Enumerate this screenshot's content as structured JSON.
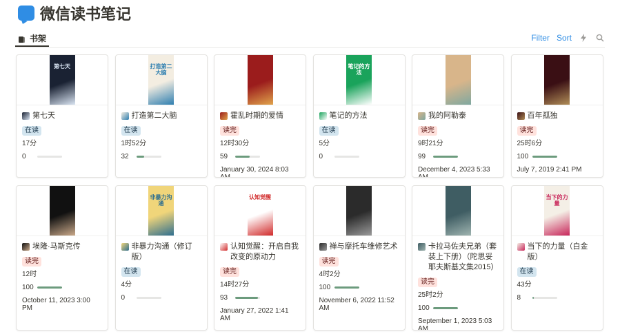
{
  "app": {
    "title": "微信读书笔记"
  },
  "view": {
    "tab_label": "书架",
    "filter_label": "Filter",
    "sort_label": "Sort",
    "lightning_icon": "lightning-icon",
    "search_icon": "search-icon"
  },
  "colors": {
    "accent": "#2f8de4",
    "reading_tag_bg": "#d3e5ef",
    "done_tag_bg": "#ffe2dd",
    "progress": "#6c9b7d"
  },
  "books": [
    {
      "title": "第七天",
      "status": "在读",
      "status_type": "reading",
      "time": "17分",
      "progress_label": "0",
      "progress": 0,
      "date": "",
      "cover_colors": [
        "#1a2233",
        "#d9e4f2"
      ],
      "cover_text": "第七天"
    },
    {
      "title": "打造第二大脑",
      "status": "在读",
      "status_type": "reading",
      "time": "1时52分",
      "progress_label": "32",
      "progress": 32,
      "date": "",
      "cover_colors": [
        "#f3ede1",
        "#2f7fb0"
      ],
      "cover_text": "打造第二大脑"
    },
    {
      "title": "霍乱时期的爱情",
      "status": "读完",
      "status_type": "done",
      "time": "12时30分",
      "progress_label": "59",
      "progress": 59,
      "date": "January 30, 2024 8:03 AM",
      "cover_colors": [
        "#9b1c1c",
        "#e0a34b"
      ],
      "cover_text": ""
    },
    {
      "title": "笔记的方法",
      "status": "在读",
      "status_type": "reading",
      "time": "5分",
      "progress_label": "0",
      "progress": 0,
      "date": "",
      "cover_colors": [
        "#1aa35b",
        "#ffffff"
      ],
      "cover_text": "笔记的方法"
    },
    {
      "title": "我的阿勒泰",
      "status": "读完",
      "status_type": "done",
      "time": "9时21分",
      "progress_label": "99",
      "progress": 99,
      "date": "December 4, 2023 5:33 AM",
      "cover_colors": [
        "#d8b58a",
        "#7fa8a0"
      ],
      "cover_text": ""
    },
    {
      "title": "百年孤独",
      "status": "读完",
      "status_type": "done",
      "time": "25时6分",
      "progress_label": "100",
      "progress": 100,
      "date": "July 7, 2019 2:41 PM",
      "cover_colors": [
        "#3a0f14",
        "#b08d57"
      ],
      "cover_text": ""
    },
    {
      "title": "埃隆·马斯克传",
      "status": "读完",
      "status_type": "done",
      "time": "12时",
      "progress_label": "100",
      "progress": 100,
      "date": "October 11, 2023 3:00 PM",
      "cover_colors": [
        "#111111",
        "#caa98a"
      ],
      "cover_text": ""
    },
    {
      "title": "非暴力沟通（修订版）",
      "status": "在读",
      "status_type": "reading",
      "time": "4分",
      "progress_label": "0",
      "progress": 0,
      "date": "",
      "cover_colors": [
        "#f0d57a",
        "#2f6f8f"
      ],
      "cover_text": "非暴力沟通"
    },
    {
      "title": "认知觉醒：开启自我改变的原动力",
      "status": "读完",
      "status_type": "done",
      "time": "14时27分",
      "progress_label": "93",
      "progress": 93,
      "date": "January 27, 2022 1:41 AM",
      "cover_colors": [
        "#ffffff",
        "#d12a2a"
      ],
      "cover_text": "认知觉醒"
    },
    {
      "title": "禅与摩托车维修艺术",
      "status": "读完",
      "status_type": "done",
      "time": "4时2分",
      "progress_label": "100",
      "progress": 100,
      "date": "November 6, 2022 11:52 AM",
      "cover_colors": [
        "#2b2b2b",
        "#9a9a9a"
      ],
      "cover_text": ""
    },
    {
      "title": "卡拉马佐夫兄弟（套装上下册）（陀思妥耶夫斯基文集2015）",
      "status": "读完",
      "status_type": "done",
      "time": "25时2分",
      "progress_label": "100",
      "progress": 100,
      "date": "September 1, 2023 5:03 AM",
      "cover_colors": [
        "#3f5d63",
        "#9fb4b0"
      ],
      "cover_text": ""
    },
    {
      "title": "当下的力量（白金版）",
      "status": "在读",
      "status_type": "reading",
      "time": "43分",
      "progress_label": "8",
      "progress": 8,
      "date": "",
      "cover_colors": [
        "#f4efe6",
        "#c8265a"
      ],
      "cover_text": "当下的力量"
    }
  ]
}
